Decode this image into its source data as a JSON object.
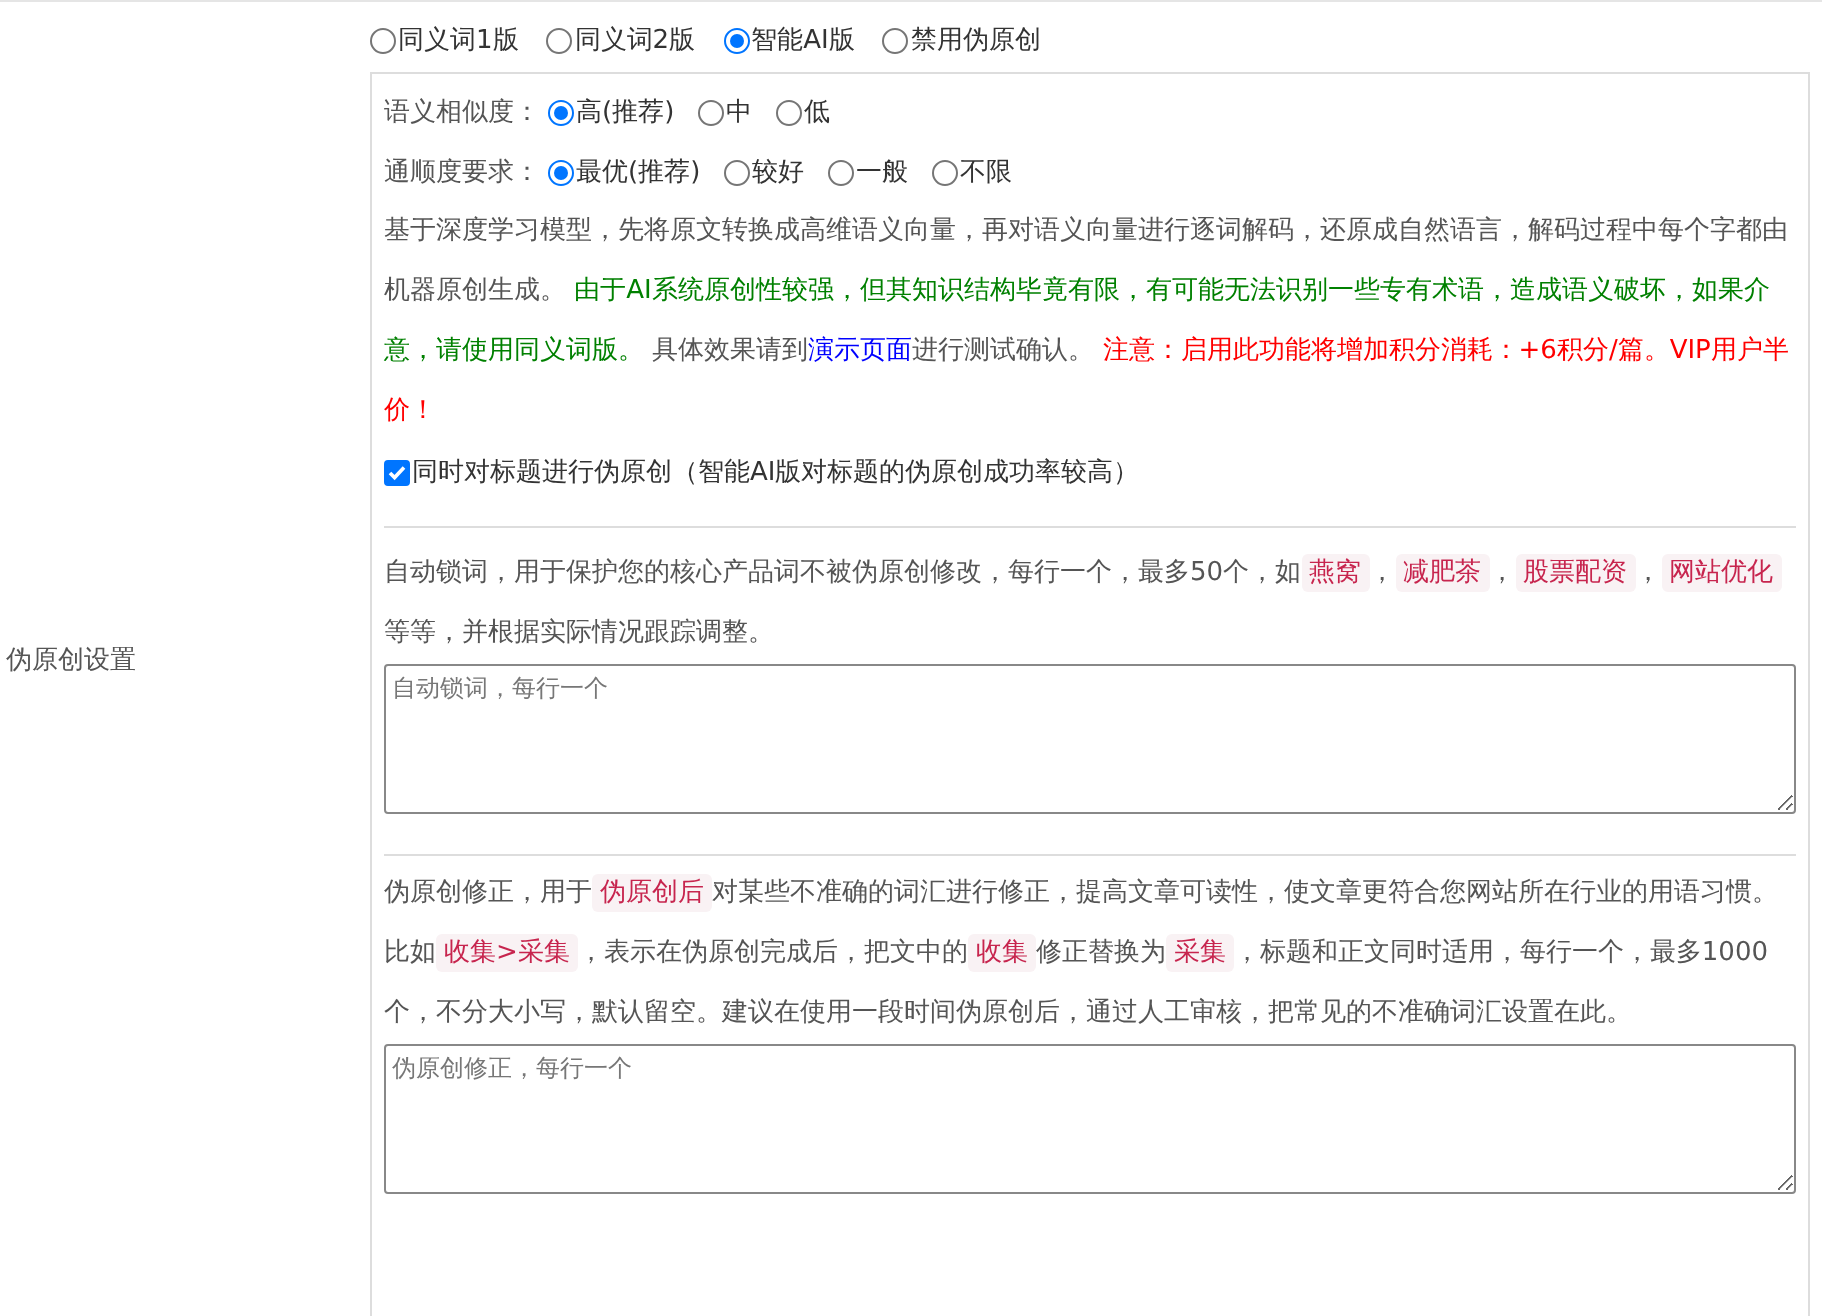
{
  "side_label": "伪原创设置",
  "modes": [
    {
      "label": "同义词1版",
      "selected": false
    },
    {
      "label": "同义词2版",
      "selected": false
    },
    {
      "label": "智能AI版",
      "selected": true
    },
    {
      "label": "禁用伪原创",
      "selected": false
    }
  ],
  "ai_box": {
    "settings": [
      {
        "label": "语义相似度：",
        "options": [
          {
            "label": "高(推荐)",
            "selected": true
          },
          {
            "label": "中",
            "selected": false
          },
          {
            "label": "低",
            "selected": false
          }
        ]
      },
      {
        "label": "通顺度要求：",
        "options": [
          {
            "label": "最优(推荐)",
            "selected": true
          },
          {
            "label": "较好",
            "selected": false
          },
          {
            "label": "一般",
            "selected": false
          },
          {
            "label": "不限",
            "selected": false
          }
        ]
      }
    ],
    "description": [
      {
        "kind": "plain",
        "text": "基于深度学习模型，先将原文转换成高维语义向量，再对语义向量进行逐词解码，还原成自然语言，解码过程中每个字都由机器原创生成。 "
      },
      {
        "kind": "green",
        "text": "由于AI系统原创性较强，但其知识结构毕竟有限，有可能无法识别一些专有术语，造成语义破坏，如果介意，请使用同义词版。"
      },
      {
        "kind": "plain",
        "text": " 具体效果请到"
      },
      {
        "kind": "link",
        "text": "演示页面"
      },
      {
        "kind": "plain",
        "text": "进行测试确认。 "
      },
      {
        "kind": "red",
        "text": "注意：启用此功能将增加积分消耗：+6积分/篇。VIP用户半价！"
      }
    ],
    "title_option": {
      "label": "同时对标题进行伪原创（智能AI版对标题的伪原创成功率较高）",
      "checked": true
    }
  },
  "lock_words": {
    "description": [
      {
        "kind": "plain",
        "text": "自动锁词，用于保护您的核心产品词不被伪原创修改，每行一个，最多50个，如"
      },
      {
        "kind": "code",
        "text": "燕窝"
      },
      {
        "kind": "plain",
        "text": "，"
      },
      {
        "kind": "code",
        "text": "减肥茶"
      },
      {
        "kind": "plain",
        "text": "，"
      },
      {
        "kind": "code",
        "text": "股票配资"
      },
      {
        "kind": "plain",
        "text": "，"
      },
      {
        "kind": "code",
        "text": "网站优化"
      },
      {
        "kind": "plain",
        "text": " 等等，并根据实际情况跟踪调整。"
      }
    ],
    "placeholder": "自动锁词，每行一个"
  },
  "corrections": {
    "description": [
      {
        "kind": "plain",
        "text": "伪原创修正，用于"
      },
      {
        "kind": "code",
        "text": "伪原创后"
      },
      {
        "kind": "plain",
        "text": "对某些不准确的词汇进行修正，提高文章可读性，使文章更符合您网站所在行业的用语习惯。比如"
      },
      {
        "kind": "code",
        "text": "收集>采集"
      },
      {
        "kind": "plain",
        "text": "，表示在伪原创完成后，把文中的"
      },
      {
        "kind": "code",
        "text": "收集"
      },
      {
        "kind": "plain",
        "text": "修正替换为"
      },
      {
        "kind": "code",
        "text": "采集"
      },
      {
        "kind": "plain",
        "text": "，标题和正文同时适用，每行一个，最多1000个，不分大小写，默认留空。建议在使用一段时间伪原创后，通过人工审核，把常见的不准确词汇设置在此。"
      }
    ],
    "placeholder": "伪原创修正，每行一个"
  }
}
